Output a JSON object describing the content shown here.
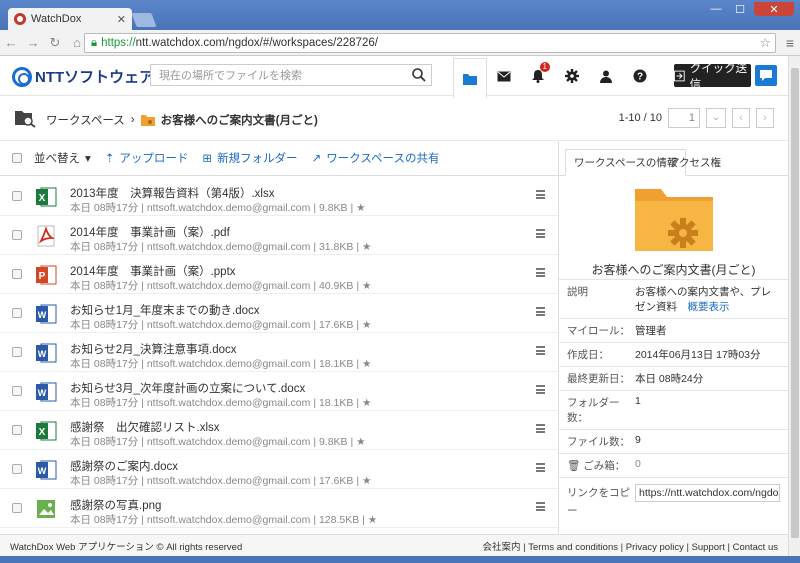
{
  "browser": {
    "tab_title": "WatchDox",
    "url_https": "https://",
    "url_rest": "ntt.watchdox.com/ngdox/#/workspaces/228726/"
  },
  "header": {
    "logo_text": "NTTソフトウェア",
    "search_placeholder": "現在の場所でファイルを検索",
    "notification_count": "1",
    "quick_send_label": "クイック送信",
    "icons": [
      "folder-icon",
      "mail-icon",
      "bell-icon",
      "gear-icon",
      "user-icon",
      "help-icon",
      "chat-icon"
    ]
  },
  "breadcrumb": {
    "root": "ワークスペース",
    "separator": "›",
    "current": "お客様へのご案内文書(月ごと)"
  },
  "pager": {
    "range": "1-10 / 10",
    "page": "1"
  },
  "toolbar": {
    "sort": "並べ替え",
    "upload": "アップロード",
    "new_folder": "新規フォルダー",
    "share": "ワークスペースの共有"
  },
  "files": [
    {
      "name": "2013年度　決算報告資料（第4版）.xlsx",
      "meta": "本日 08時17分 | nttsoft.watchdox.demo@gmail.com | 9.8KB | ★",
      "type": "excel"
    },
    {
      "name": "2014年度　事業計画（案）.pdf",
      "meta": "本日 08時17分 | nttsoft.watchdox.demo@gmail.com | 31.8KB | ★",
      "type": "pdf"
    },
    {
      "name": "2014年度　事業計画（案）.pptx",
      "meta": "本日 08時17分 | nttsoft.watchdox.demo@gmail.com | 40.9KB | ★",
      "type": "ppt"
    },
    {
      "name": "お知らせ1月_年度末までの動き.docx",
      "meta": "本日 08時17分 | nttsoft.watchdox.demo@gmail.com | 17.6KB | ★",
      "type": "word"
    },
    {
      "name": "お知らせ2月_決算注意事項.docx",
      "meta": "本日 08時17分 | nttsoft.watchdox.demo@gmail.com | 18.1KB | ★",
      "type": "word"
    },
    {
      "name": "お知らせ3月_次年度計画の立案について.docx",
      "meta": "本日 08時17分 | nttsoft.watchdox.demo@gmail.com | 18.1KB | ★",
      "type": "word"
    },
    {
      "name": "感謝祭　出欠確認リスト.xlsx",
      "meta": "本日 08時17分 | nttsoft.watchdox.demo@gmail.com | 9.8KB | ★",
      "type": "excel"
    },
    {
      "name": "感謝祭のご案内.docx",
      "meta": "本日 08時17分 | nttsoft.watchdox.demo@gmail.com | 17.6KB | ★",
      "type": "word"
    },
    {
      "name": "感謝祭の写真.png",
      "meta": "本日 08時17分 | nttsoft.watchdox.demo@gmail.com | 128.5KB | ★",
      "type": "image"
    }
  ],
  "panel": {
    "tab_info": "ワークスペースの情報",
    "tab_access": "アクセス権",
    "title": "お客様へのご案内文書(月ごと)",
    "desc_label": "説明",
    "desc_value": "お客様への案内文書や、プレゼン資料",
    "desc_link": "概要表示",
    "role_label": "マイロール：",
    "role_value": "管理者",
    "created_label": "作成日：",
    "created_value": "2014年06月13日 17時03分",
    "updated_label": "最終更新日：",
    "updated_value": "本日 08時24分",
    "folders_label": "フォルダー数：",
    "folders_value": "1",
    "files_label": "ファイル数：",
    "files_value": "9",
    "trash_label": "ごみ箱：",
    "trash_value": "0",
    "copy_label": "リンクをコピー",
    "copy_value": "https://ntt.watchdox.com/ngdox/#/w"
  },
  "footer": {
    "left": "WatchDox Web アプリケーション © All rights reserved",
    "right": "会社案内 | Terms and conditions | Privacy policy | Support | Contact us"
  },
  "colors": {
    "accent": "#1a6cc4",
    "folder": "#f0a030",
    "excel": "#1e7a3c",
    "pdf": "#d2271d",
    "ppt": "#d24726",
    "word": "#2b5aa8",
    "image": "#6ab04c"
  }
}
